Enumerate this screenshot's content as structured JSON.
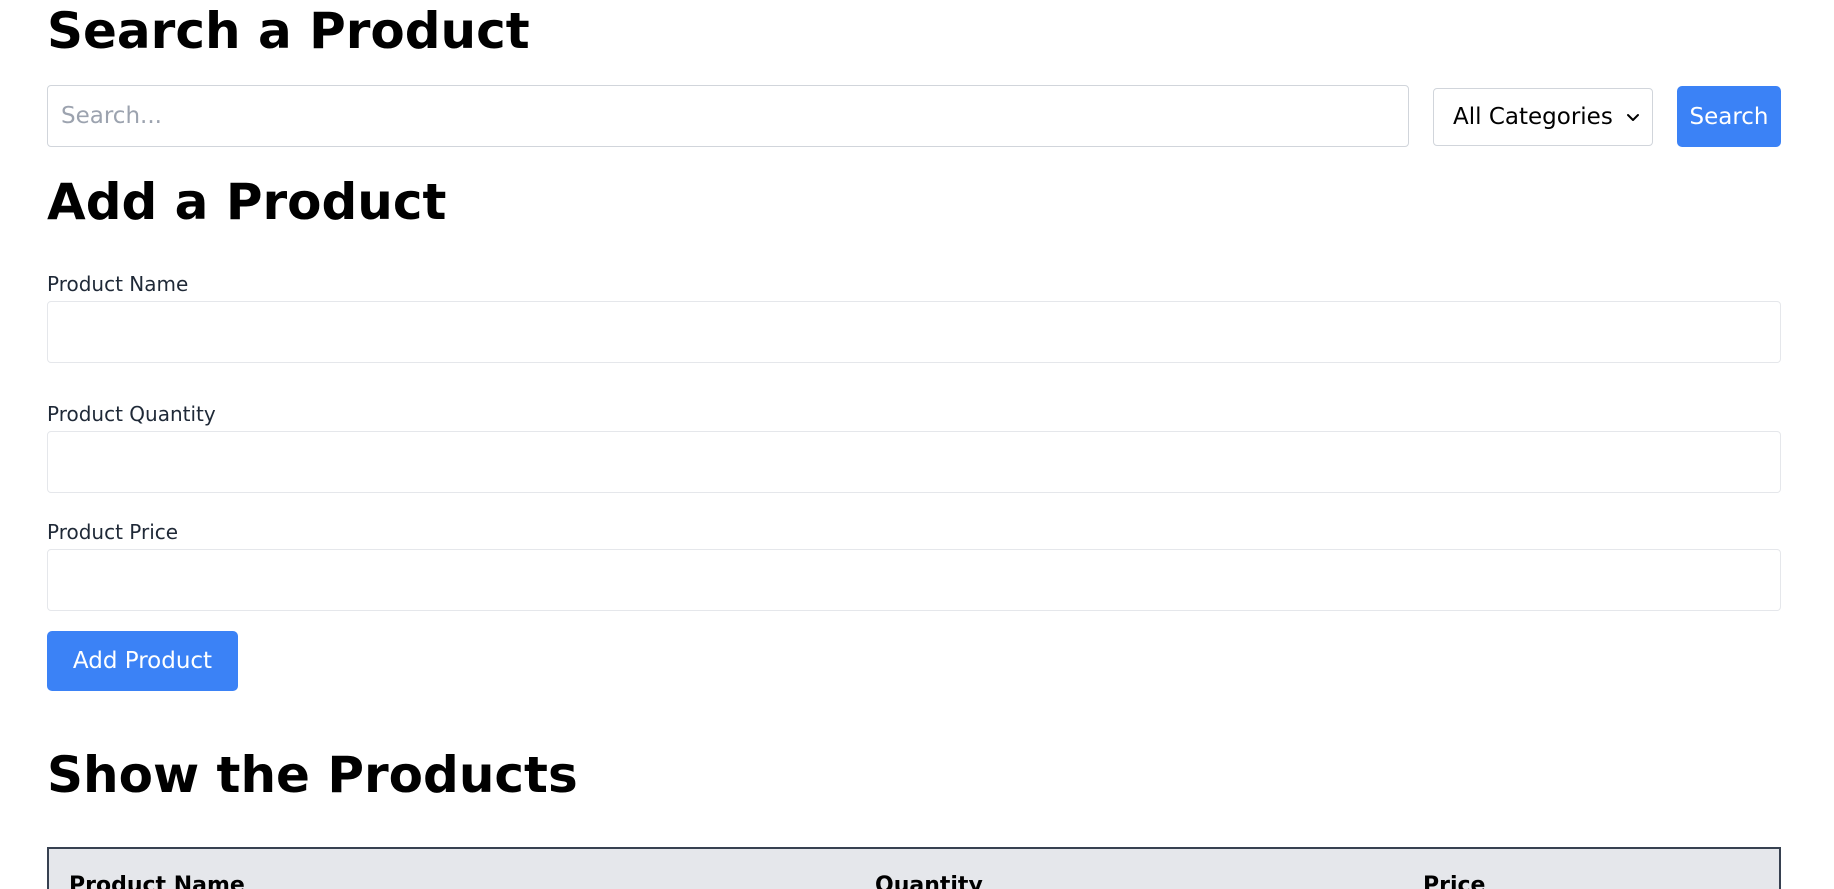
{
  "search_section": {
    "title": "Search a Product",
    "search_placeholder": "Search...",
    "search_value": "",
    "category_selected": "All Categories",
    "search_button": "Search"
  },
  "add_section": {
    "title": "Add a Product",
    "fields": [
      {
        "label": "Product Name",
        "value": ""
      },
      {
        "label": "Product Quantity",
        "value": ""
      },
      {
        "label": "Product Price",
        "value": ""
      }
    ],
    "add_button": "Add Product"
  },
  "show_section": {
    "title": "Show the Products",
    "table": {
      "columns": [
        "Product Name",
        "Quantity",
        "Price"
      ],
      "rows": []
    }
  },
  "colors": {
    "accent": "#3b82f6",
    "table_header_bg": "#e5e7eb",
    "table_border": "#374151"
  }
}
